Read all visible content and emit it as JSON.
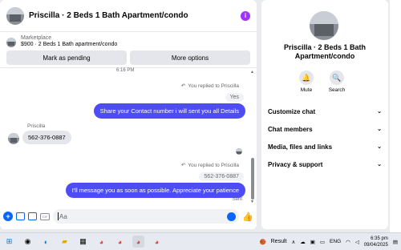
{
  "header": {
    "title": "Priscilla · 2 Beds 1 Bath Apartment/condo"
  },
  "marketplace": {
    "label": "Marketplace",
    "listing": "$900 · 2 Beds 1 Bath apartment/condo"
  },
  "actions": {
    "mark_pending": "Mark as pending",
    "more_options": "More options"
  },
  "messages": {
    "time_separator": "6:16 PM",
    "reply1_note": "You replied to Priscilla",
    "reply1_quoted": "Yes",
    "reply1_text": "Share your Contact number i will sent you all Details",
    "sender_name": "Priscilla",
    "incoming_text": "562-376-0887",
    "reply2_note": "You replied to Priscilla",
    "reply2_quoted": "562-376-0887",
    "reply2_text": "I'll message you as soon as possible. Appreciate your patience",
    "status": "Sent"
  },
  "composer": {
    "placeholder": "Aa"
  },
  "side": {
    "title": "Priscilla · 2 Beds 1 Bath Apartment/condo",
    "mute_label": "Mute",
    "search_label": "Search",
    "menu": [
      "Customize chat",
      "Chat members",
      "Media, files and links",
      "Privacy & support"
    ]
  },
  "taskbar": {
    "result_label": "Result",
    "lang": "ENG",
    "time": "6:35 pm",
    "date": "09/04/2025"
  },
  "colors": {
    "accent": "#0866ff",
    "outgoing_bubble": "#4e4cf5",
    "info": "#a033ff"
  }
}
